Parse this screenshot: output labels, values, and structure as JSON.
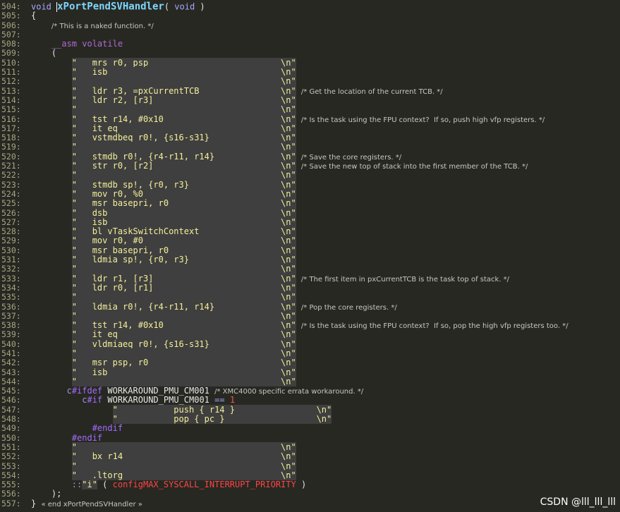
{
  "editor": {
    "lines": [
      {
        "n": "504:",
        "parts": [
          [
            "kw",
            "void "
          ],
          [
            "cursor",
            ""
          ],
          [
            "fn",
            "xPortPendSVHandler"
          ],
          [
            "ident",
            "( "
          ],
          [
            "kw",
            "void"
          ],
          [
            "ident",
            " )"
          ]
        ]
      },
      {
        "n": "505:",
        "parts": [
          [
            "ident",
            "{"
          ]
        ]
      },
      {
        "n": "506:",
        "parts": [
          [
            "ident",
            "    "
          ],
          [
            "cm",
            "/* This is a naked function. */"
          ]
        ]
      },
      {
        "n": "507:",
        "parts": []
      },
      {
        "n": "508:",
        "parts": [
          [
            "ident",
            "    "
          ],
          [
            "asm",
            "__asm volatile"
          ]
        ]
      },
      {
        "n": "509:",
        "parts": [
          [
            "ident",
            "    ("
          ]
        ]
      },
      {
        "n": "510:",
        "parts": [
          [
            "ident",
            "        "
          ],
          [
            "str",
            "\"   mrs r0, psp                          \\n\""
          ]
        ]
      },
      {
        "n": "511:",
        "parts": [
          [
            "ident",
            "        "
          ],
          [
            "str",
            "\"   isb                                  \\n\""
          ]
        ]
      },
      {
        "n": "512:",
        "parts": [
          [
            "ident",
            "        "
          ],
          [
            "str",
            "\"                                        \\n\""
          ]
        ]
      },
      {
        "n": "513:",
        "parts": [
          [
            "ident",
            "        "
          ],
          [
            "str",
            "\"   ldr r3, =pxCurrentTCB                \\n\""
          ],
          [
            "ident",
            " "
          ],
          [
            "cm",
            "/* Get the location of the current TCB. */"
          ]
        ]
      },
      {
        "n": "514:",
        "parts": [
          [
            "ident",
            "        "
          ],
          [
            "str",
            "\"   ldr r2, [r3]                         \\n\""
          ]
        ]
      },
      {
        "n": "515:",
        "parts": [
          [
            "ident",
            "        "
          ],
          [
            "str",
            "\"                                        \\n\""
          ]
        ]
      },
      {
        "n": "516:",
        "parts": [
          [
            "ident",
            "        "
          ],
          [
            "str",
            "\"   tst r14, #0x10                       \\n\""
          ],
          [
            "ident",
            " "
          ],
          [
            "cm",
            "/* Is the task using the FPU context?  If so, push high vfp registers. */"
          ]
        ]
      },
      {
        "n": "517:",
        "parts": [
          [
            "ident",
            "        "
          ],
          [
            "str",
            "\"   it eq                                \\n\""
          ]
        ]
      },
      {
        "n": "518:",
        "parts": [
          [
            "ident",
            "        "
          ],
          [
            "str",
            "\"   vstmdbeq r0!, {s16-s31}              \\n\""
          ]
        ]
      },
      {
        "n": "519:",
        "parts": [
          [
            "ident",
            "        "
          ],
          [
            "str",
            "\"                                        \\n\""
          ]
        ]
      },
      {
        "n": "520:",
        "parts": [
          [
            "ident",
            "        "
          ],
          [
            "str",
            "\"   stmdb r0!, {r4-r11, r14}             \\n\""
          ],
          [
            "ident",
            " "
          ],
          [
            "cm",
            "/* Save the core registers. */"
          ]
        ]
      },
      {
        "n": "521:",
        "parts": [
          [
            "ident",
            "        "
          ],
          [
            "str",
            "\"   str r0, [r2]                         \\n\""
          ],
          [
            "ident",
            " "
          ],
          [
            "cm",
            "/* Save the new top of stack into the first member of the TCB. */"
          ]
        ]
      },
      {
        "n": "522:",
        "parts": [
          [
            "ident",
            "        "
          ],
          [
            "str",
            "\"                                        \\n\""
          ]
        ]
      },
      {
        "n": "523:",
        "parts": [
          [
            "ident",
            "        "
          ],
          [
            "str",
            "\"   stmdb sp!, {r0, r3}                  \\n\""
          ]
        ]
      },
      {
        "n": "524:",
        "parts": [
          [
            "ident",
            "        "
          ],
          [
            "str",
            "\"   mov r0, %0                           \\n\""
          ]
        ]
      },
      {
        "n": "525:",
        "parts": [
          [
            "ident",
            "        "
          ],
          [
            "str",
            "\"   msr basepri, r0                      \\n\""
          ]
        ]
      },
      {
        "n": "526:",
        "parts": [
          [
            "ident",
            "        "
          ],
          [
            "str",
            "\"   dsb                                  \\n\""
          ]
        ]
      },
      {
        "n": "527:",
        "parts": [
          [
            "ident",
            "        "
          ],
          [
            "str",
            "\"   isb                                  \\n\""
          ]
        ]
      },
      {
        "n": "528:",
        "parts": [
          [
            "ident",
            "        "
          ],
          [
            "str",
            "\"   bl vTaskSwitchContext                \\n\""
          ]
        ]
      },
      {
        "n": "529:",
        "parts": [
          [
            "ident",
            "        "
          ],
          [
            "str",
            "\"   mov r0, #0                           \\n\""
          ]
        ]
      },
      {
        "n": "530:",
        "parts": [
          [
            "ident",
            "        "
          ],
          [
            "str",
            "\"   msr basepri, r0                      \\n\""
          ]
        ]
      },
      {
        "n": "531:",
        "parts": [
          [
            "ident",
            "        "
          ],
          [
            "str",
            "\"   ldmia sp!, {r0, r3}                  \\n\""
          ]
        ]
      },
      {
        "n": "532:",
        "parts": [
          [
            "ident",
            "        "
          ],
          [
            "str",
            "\"                                        \\n\""
          ]
        ]
      },
      {
        "n": "533:",
        "parts": [
          [
            "ident",
            "        "
          ],
          [
            "str",
            "\"   ldr r1, [r3]                         \\n\""
          ],
          [
            "ident",
            " "
          ],
          [
            "cm",
            "/* The first item in pxCurrentTCB is the task top of stack. */"
          ]
        ]
      },
      {
        "n": "534:",
        "parts": [
          [
            "ident",
            "        "
          ],
          [
            "str",
            "\"   ldr r0, [r1]                         \\n\""
          ]
        ]
      },
      {
        "n": "535:",
        "parts": [
          [
            "ident",
            "        "
          ],
          [
            "str",
            "\"                                        \\n\""
          ]
        ]
      },
      {
        "n": "536:",
        "parts": [
          [
            "ident",
            "        "
          ],
          [
            "str",
            "\"   ldmia r0!, {r4-r11, r14}             \\n\""
          ],
          [
            "ident",
            " "
          ],
          [
            "cm",
            "/* Pop the core registers. */"
          ]
        ]
      },
      {
        "n": "537:",
        "parts": [
          [
            "ident",
            "        "
          ],
          [
            "str",
            "\"                                        \\n\""
          ]
        ]
      },
      {
        "n": "538:",
        "parts": [
          [
            "ident",
            "        "
          ],
          [
            "str",
            "\"   tst r14, #0x10                       \\n\""
          ],
          [
            "ident",
            " "
          ],
          [
            "cm",
            "/* Is the task using the FPU context?  If so, pop the high vfp registers too. */"
          ]
        ]
      },
      {
        "n": "539:",
        "parts": [
          [
            "ident",
            "        "
          ],
          [
            "str",
            "\"   it eq                                \\n\""
          ]
        ]
      },
      {
        "n": "540:",
        "parts": [
          [
            "ident",
            "        "
          ],
          [
            "str",
            "\"   vldmiaeq r0!, {s16-s31}              \\n\""
          ]
        ]
      },
      {
        "n": "541:",
        "parts": [
          [
            "ident",
            "        "
          ],
          [
            "str",
            "\"                                        \\n\""
          ]
        ]
      },
      {
        "n": "542:",
        "parts": [
          [
            "ident",
            "        "
          ],
          [
            "str",
            "\"   msr psp, r0                          \\n\""
          ]
        ]
      },
      {
        "n": "543:",
        "parts": [
          [
            "ident",
            "        "
          ],
          [
            "str",
            "\"   isb                                  \\n\""
          ]
        ]
      },
      {
        "n": "544:",
        "parts": [
          [
            "ident",
            "        "
          ],
          [
            "str",
            "\"                                        \\n\""
          ]
        ]
      },
      {
        "n": "545:",
        "parts": [
          [
            "ident",
            "       "
          ],
          [
            "fold",
            "c"
          ],
          [
            "pre",
            "#ifdef"
          ],
          [
            "ident",
            " WORKAROUND_PMU_CM001 "
          ],
          [
            "cm",
            "/* XMC4000 specific errata workaround. */"
          ]
        ]
      },
      {
        "n": "546:",
        "parts": [
          [
            "ident",
            "          "
          ],
          [
            "fold",
            "c"
          ],
          [
            "pre",
            "#if"
          ],
          [
            "ident",
            " WORKAROUND_PMU_CM001 "
          ],
          [
            "kw",
            "=="
          ],
          [
            "ident",
            " "
          ],
          [
            "num",
            "1"
          ]
        ]
      },
      {
        "n": "547:",
        "parts": [
          [
            "ident",
            "                "
          ],
          [
            "str",
            "\"           push { r14 }                \\n\""
          ]
        ]
      },
      {
        "n": "548:",
        "parts": [
          [
            "ident",
            "                "
          ],
          [
            "str",
            "\"           pop { pc }                  \\n\""
          ]
        ]
      },
      {
        "n": "549:",
        "parts": [
          [
            "ident",
            "            "
          ],
          [
            "pre",
            "#endif"
          ]
        ]
      },
      {
        "n": "550:",
        "parts": [
          [
            "ident",
            "        "
          ],
          [
            "pre",
            "#endif"
          ]
        ]
      },
      {
        "n": "551:",
        "parts": [
          [
            "ident",
            "        "
          ],
          [
            "str",
            "\"                                        \\n\""
          ]
        ]
      },
      {
        "n": "552:",
        "parts": [
          [
            "ident",
            "        "
          ],
          [
            "str",
            "\"   bx r14                               \\n\""
          ]
        ]
      },
      {
        "n": "553:",
        "parts": [
          [
            "ident",
            "        "
          ],
          [
            "str",
            "\"                                        \\n\""
          ]
        ]
      },
      {
        "n": "554:",
        "parts": [
          [
            "ident",
            "        "
          ],
          [
            "str",
            "\"   .ltorg                               \\n\""
          ]
        ]
      },
      {
        "n": "555:",
        "parts": [
          [
            "ident",
            "        "
          ],
          [
            "fold",
            "::"
          ],
          [
            "str",
            "\"i\""
          ],
          [
            "ident",
            " ( "
          ],
          [
            "mac",
            "configMAX_SYSCALL_INTERRUPT_PRIORITY"
          ],
          [
            "ident",
            " )"
          ]
        ]
      },
      {
        "n": "556:",
        "parts": [
          [
            "ident",
            "    );"
          ]
        ]
      },
      {
        "n": "557:",
        "parts": [
          [
            "ident",
            "} "
          ],
          [
            "cm",
            "« end xPortPendSVHandler »"
          ]
        ]
      }
    ]
  },
  "watermark": "CSDN @lll_lll_lll"
}
